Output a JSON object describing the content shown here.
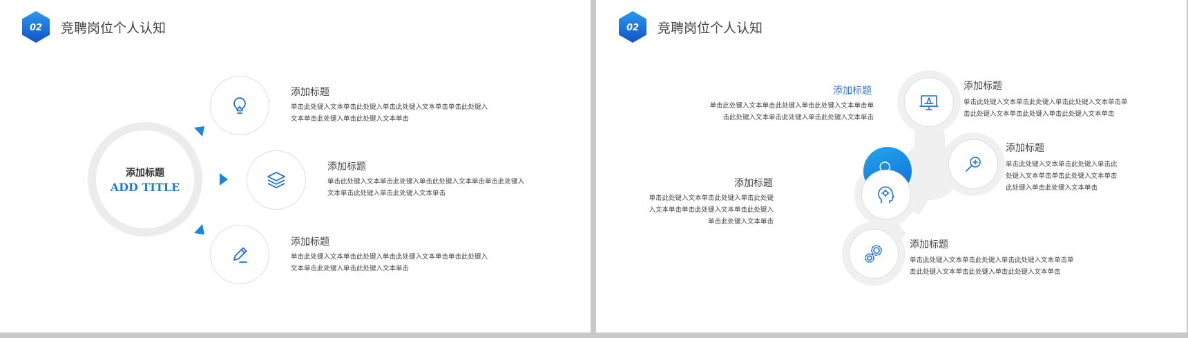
{
  "colors": {
    "accent": "#1a86e0",
    "accent_dark": "#1458c8",
    "title_blue": "#2f77c8",
    "ring_gray": "#ececec",
    "text": "#444444"
  },
  "left_slide": {
    "badge": "02",
    "title": "竞聘岗位个人认知",
    "center_title": "添加标题",
    "center_subtitle": "ADD TITLE",
    "items": [
      {
        "icon": "lightbulb-icon",
        "title": "添加标题",
        "body_line1": "单击此处键入文本单击此处键入单击此处键入文本单击单击此处键入",
        "body_line2": "文本单击此处键入单击此处键入文本单击"
      },
      {
        "icon": "layers-icon",
        "title": "添加标题",
        "body_line1": "单击此处键入文本单击此处键入单击此处键入文本单击单击此处键入",
        "body_line2": "文本单击此处键入单击此处键入文本单击"
      },
      {
        "icon": "pencil-icon",
        "title": "添加标题",
        "body_line1": "单击此处键入文本单击此处键入单击此处键入文本单击单击此处键入",
        "body_line2": "文本单击此处键入单击此处键入文本单击"
      }
    ]
  },
  "right_slide": {
    "badge": "02",
    "title": "竞聘岗位个人认知",
    "items": [
      {
        "icon": "presentation-icon",
        "title": "添加标题",
        "body_line1": "单击此处键入文本单击此处键入单击此处键入文本单击单",
        "body_line2": "击此处键入文本单击此处键入单击此处键入文本单击"
      },
      {
        "icon": "search-plus-icon",
        "title": "添加标题",
        "body_line1": "单击此处键入文本单击此处键入单击此",
        "body_line2": "处键入文本单击单击此处键入文本单击",
        "body_line3": "此处键入单击此处键入文本单击"
      },
      {
        "icon": "gears-icon",
        "title": "添加标题",
        "body_line1": "单击此处键入文本单击此处键入单击此处键入文本单击单",
        "body_line2": "击此处键入文本单击此处键入单击此处键入文本单击"
      },
      {
        "icon": "head-gear-icon",
        "title": "添加标题",
        "body_line1": "单击此处键入文本单击此处键入单击此处键",
        "body_line2": "入文本单击单击此处键入文本单击此处键入",
        "body_line3": "单击此处键入文本单击"
      },
      {
        "icon": "idea-blue-icon",
        "title": "添加标题",
        "body_line1": "单击此处键入文本单击此处键入单击此处键入文本单击单",
        "body_line2": "击此处键入文本单击此处键入单击此处键入文本单击"
      }
    ]
  }
}
